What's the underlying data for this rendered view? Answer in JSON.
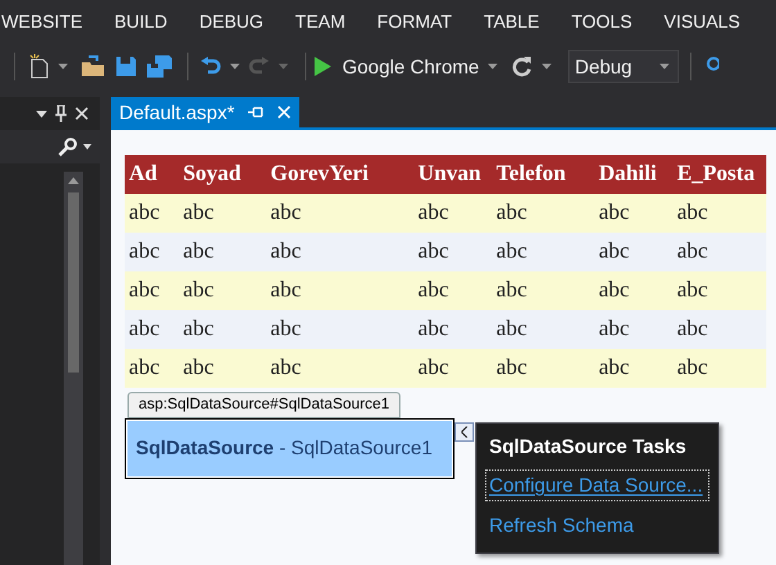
{
  "menu": [
    "WEBSITE",
    "BUILD",
    "DEBUG",
    "TEAM",
    "FORMAT",
    "TABLE",
    "TOOLS",
    "VISUALS"
  ],
  "toolbar": {
    "redo": {
      "disabled": true
    },
    "browser": "Google Chrome",
    "configuration": "Debug"
  },
  "document_tab": {
    "title": "Default.aspx*",
    "selected": true
  },
  "table": {
    "columns": [
      "Ad",
      "Soyad",
      "GorevYeri",
      "Unvan",
      "Telefon",
      "Dahili",
      "E_Posta"
    ],
    "rows": [
      [
        "abc",
        "abc",
        "abc",
        "abc",
        "abc",
        "abc",
        "abc"
      ],
      [
        "abc",
        "abc",
        "abc",
        "abc",
        "abc",
        "abc",
        "abc"
      ],
      [
        "abc",
        "abc",
        "abc",
        "abc",
        "abc",
        "abc",
        "abc"
      ],
      [
        "abc",
        "abc",
        "abc",
        "abc",
        "abc",
        "abc",
        "abc"
      ],
      [
        "abc",
        "abc",
        "abc",
        "abc",
        "abc",
        "abc",
        "abc"
      ]
    ]
  },
  "control": {
    "tag": "asp:SqlDataSource#SqlDataSource1",
    "label": "**SqlDataSource** - SqlDataSource1"
  },
  "tasks_panel": {
    "title": "SqlDataSource Tasks",
    "items": [
      {
        "label": "Configure Data Source...",
        "selected": true
      },
      {
        "label": "Refresh Schema",
        "selected": false
      }
    ]
  }
}
